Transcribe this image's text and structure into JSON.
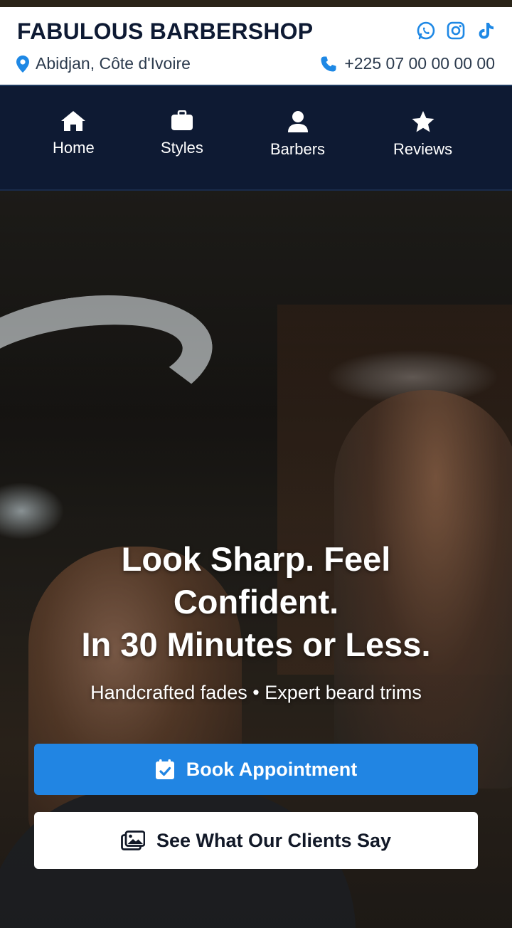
{
  "header": {
    "brand": "FABULOUS BARBERSHOP",
    "location": "Abidjan, Côte d'Ivoire",
    "phone": "+225 07 00 00 00 00",
    "socials": [
      "whatsapp-icon",
      "instagram-icon",
      "tiktok-icon"
    ],
    "accent": "#1e88e5"
  },
  "nav": {
    "items": [
      {
        "label": "Home",
        "icon": "home-icon"
      },
      {
        "label": "Styles",
        "icon": "briefcase-icon"
      },
      {
        "label": "Barbers",
        "icon": "user-icon"
      },
      {
        "label": "Reviews",
        "icon": "star-icon"
      }
    ],
    "background": "#0e1a33"
  },
  "hero": {
    "title_line1": "Look Sharp. Feel",
    "title_line2": "Confident.",
    "title_line3": "In 30 Minutes or Less.",
    "subtitle": "Handcrafted fades • Expert beard trims",
    "primary_button": "Book Appointment",
    "secondary_button": "See What Our Clients Say",
    "primary_color": "#2185e3"
  }
}
